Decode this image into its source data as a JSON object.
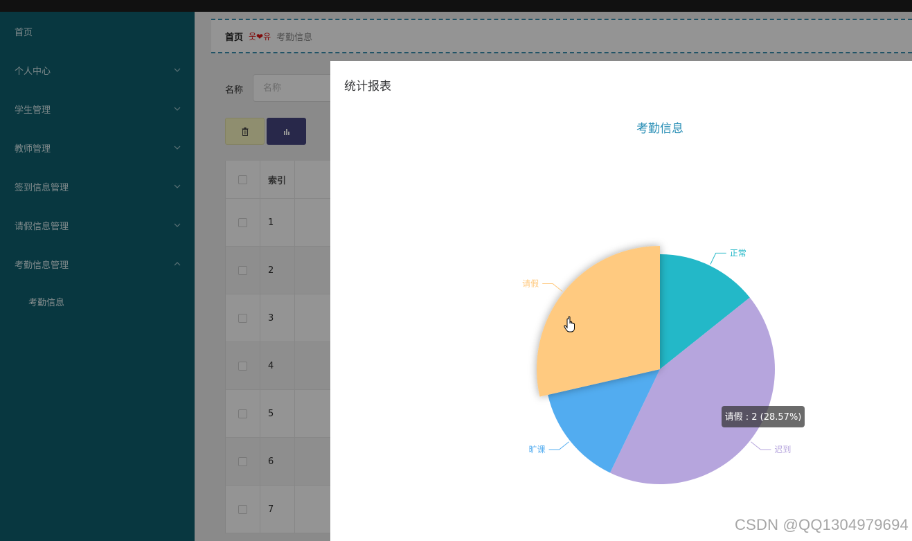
{
  "sidebar": {
    "items": [
      {
        "label": "首页",
        "has_chevron": false
      },
      {
        "label": "个人中心",
        "has_chevron": true
      },
      {
        "label": "学生管理",
        "has_chevron": true
      },
      {
        "label": "教师管理",
        "has_chevron": true
      },
      {
        "label": "签到信息管理",
        "has_chevron": true
      },
      {
        "label": "请假信息管理",
        "has_chevron": true
      },
      {
        "label": "考勤信息管理",
        "has_chevron": true,
        "expanded": true
      }
    ],
    "subitem": "考勤信息"
  },
  "breadcrumb": {
    "home": "首页",
    "separator": "웃❤유",
    "current": "考勤信息"
  },
  "search": {
    "label": "名称",
    "placeholder": "名称"
  },
  "toolbar": {
    "delete_icon": "trash-icon",
    "chart_icon": "bar-chart-icon"
  },
  "table": {
    "header": "索引",
    "rows": [
      "1",
      "2",
      "3",
      "4",
      "5",
      "6",
      "7"
    ]
  },
  "modal": {
    "title": "统计报表"
  },
  "chart_data": {
    "type": "pie",
    "title": "考勤信息",
    "slices": [
      {
        "name": "正常",
        "value": 1,
        "color": "#23b8c8"
      },
      {
        "name": "迟到",
        "value": 3,
        "color": "#b6a5dd"
      },
      {
        "name": "旷课",
        "value": 1,
        "color": "#52acf0"
      },
      {
        "name": "请假",
        "value": 2,
        "color": "#ffca80"
      }
    ],
    "highlighted": "请假",
    "tooltip": "请假 : 2 (28.57%)"
  },
  "watermark": "CSDN @QQ1304979694",
  "colors": {
    "sidebar_bg": "#0e5f6e",
    "breadcrumb_border": "#3a8fb0",
    "title_color": "#2a8fb6"
  }
}
